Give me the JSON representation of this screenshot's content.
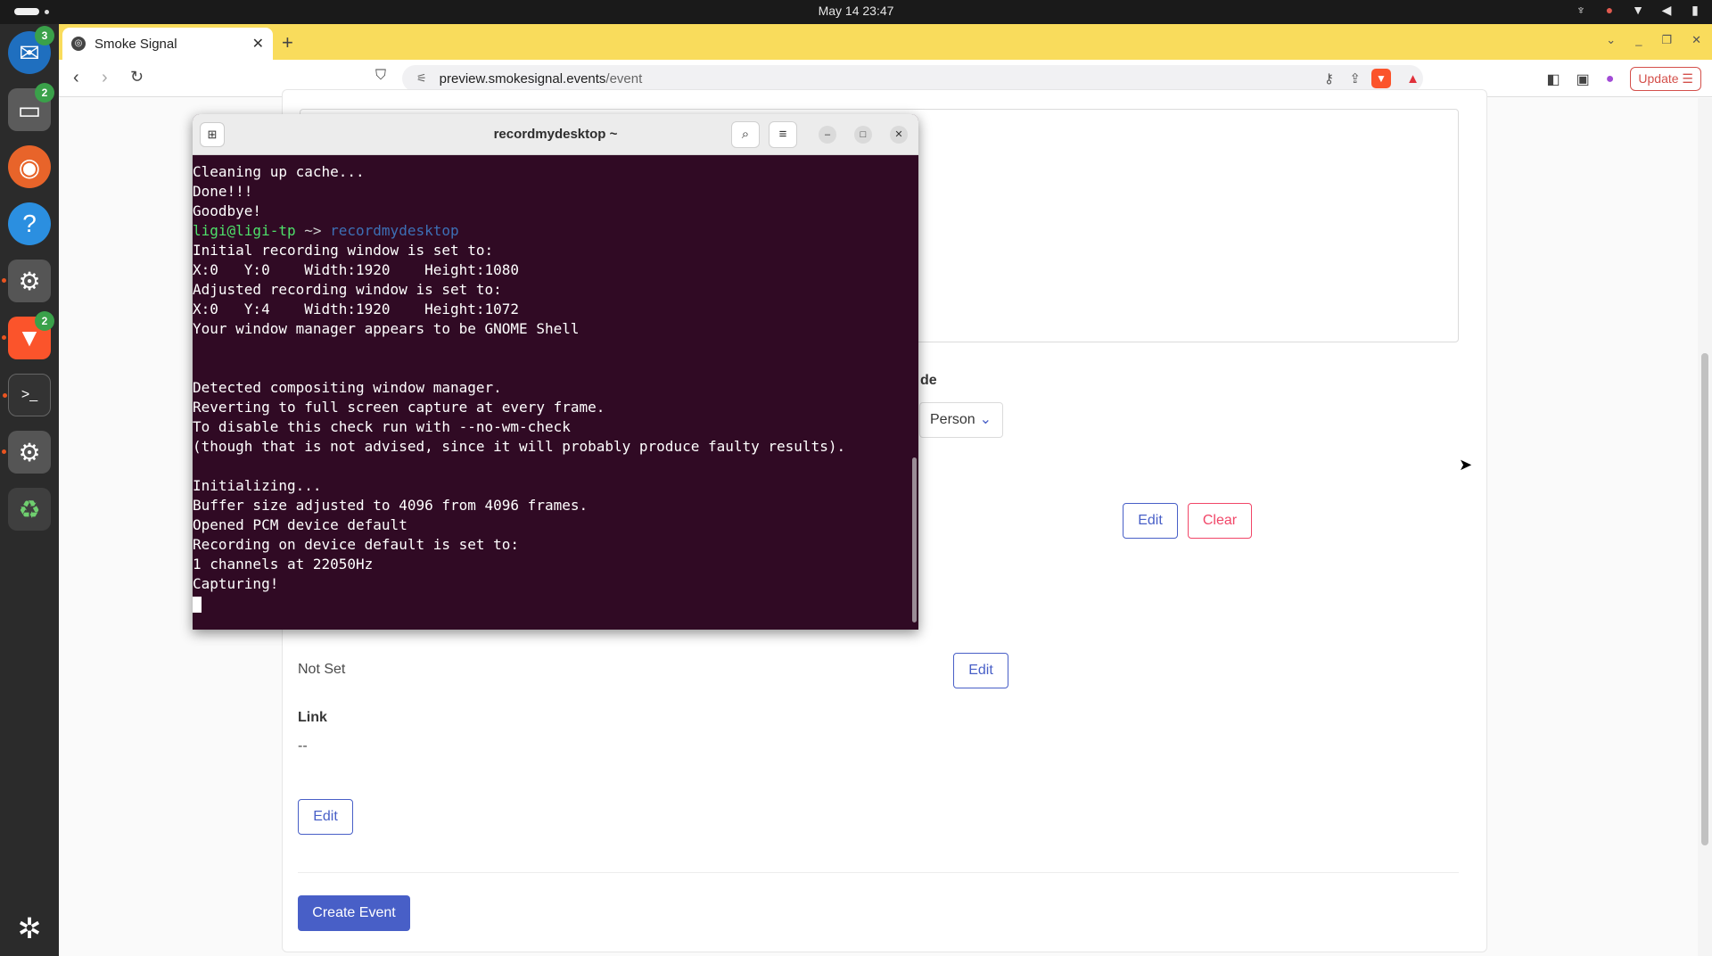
{
  "topbar": {
    "clock": "May 14  23:47"
  },
  "dock": {
    "items": [
      {
        "name": "thunderbird",
        "badge": "3"
      },
      {
        "name": "files",
        "badge": "2"
      },
      {
        "name": "firefox",
        "badge": ""
      },
      {
        "name": "help",
        "badge": ""
      },
      {
        "name": "settings",
        "badge": ""
      },
      {
        "name": "brave",
        "badge": "2"
      },
      {
        "name": "terminal",
        "badge": ""
      },
      {
        "name": "settings2",
        "badge": ""
      },
      {
        "name": "trash",
        "badge": ""
      }
    ]
  },
  "browser": {
    "tab_title": "Smoke Signal",
    "url_host": "preview.smokesignal.events",
    "url_path": "/event",
    "update_label": "Update",
    "accent": "#f9dc5c"
  },
  "page": {
    "partial_label": "de",
    "select_value": "Person",
    "edit_label": "Edit",
    "clear_label": "Clear",
    "not_set": "Not Set",
    "link_label": "Link",
    "link_value": "--",
    "create_label": "Create Event",
    "primary_color": "#485fc7",
    "danger_color": "#f14668"
  },
  "terminal": {
    "title": "recordmydesktop ~",
    "background": "#300a24",
    "lines": [
      "Cleaning up cache...",
      "Done!!!",
      "Goodbye!"
    ],
    "prompt_user": "ligi@ligi-tp",
    "prompt_arrow": " ~> ",
    "prompt_cmd": "recordmydesktop",
    "output": [
      "Initial recording window is set to:",
      "X:0   Y:0    Width:1920    Height:1080",
      "Adjusted recording window is set to:",
      "X:0   Y:4    Width:1920    Height:1072",
      "Your window manager appears to be GNOME Shell",
      "",
      "",
      "Detected compositing window manager.",
      "Reverting to full screen capture at every frame.",
      "To disable this check run with --no-wm-check",
      "(though that is not advised, since it will probably produce faulty results).",
      "",
      "Initializing...",
      "Buffer size adjusted to 4096 from 4096 frames.",
      "Opened PCM device default",
      "Recording on device default is set to:",
      "1 channels at 22050Hz",
      "Capturing!"
    ]
  }
}
